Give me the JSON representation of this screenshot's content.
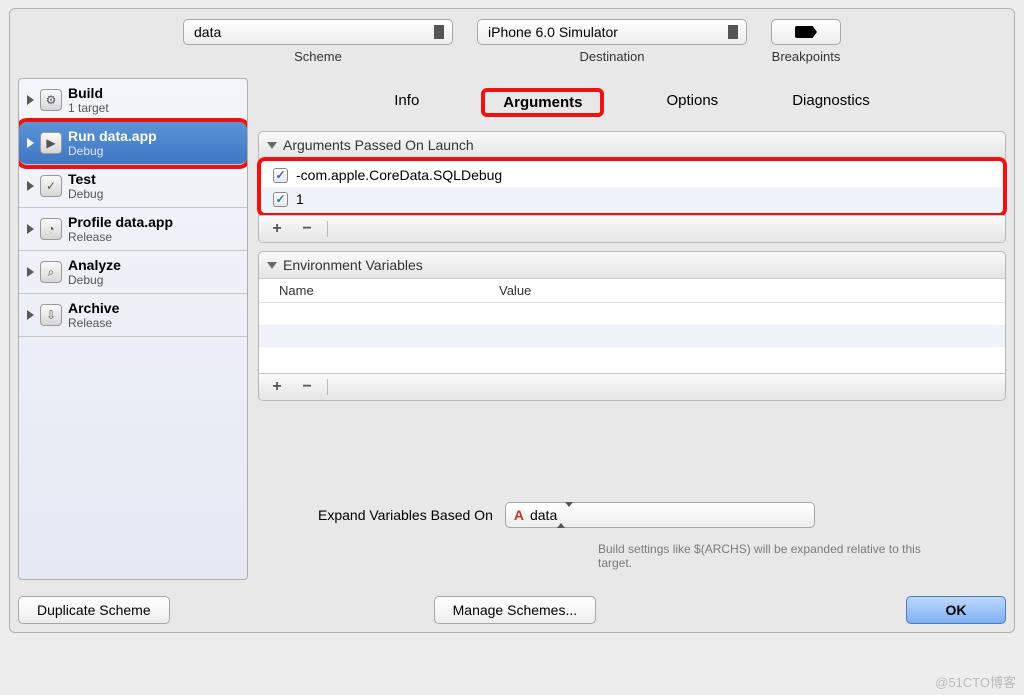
{
  "toolbar": {
    "scheme": {
      "value": "data",
      "label": "Scheme"
    },
    "destination": {
      "value": "iPhone 6.0 Simulator",
      "label": "Destination"
    },
    "breakpoints": {
      "label": "Breakpoints"
    }
  },
  "sidebar": {
    "items": [
      {
        "title": "Build",
        "sub": "1 target"
      },
      {
        "title": "Run data.app",
        "sub": "Debug"
      },
      {
        "title": "Test",
        "sub": "Debug"
      },
      {
        "title": "Profile data.app",
        "sub": "Release"
      },
      {
        "title": "Analyze",
        "sub": "Debug"
      },
      {
        "title": "Archive",
        "sub": "Release"
      }
    ]
  },
  "tabs": {
    "info": "Info",
    "arguments": "Arguments",
    "options": "Options",
    "diagnostics": "Diagnostics"
  },
  "arguments_panel": {
    "title": "Arguments Passed On Launch",
    "rows": [
      "-com.apple.CoreData.SQLDebug",
      "1"
    ]
  },
  "env_panel": {
    "title": "Environment Variables",
    "col_name": "Name",
    "col_value": "Value"
  },
  "expand": {
    "label": "Expand Variables Based On",
    "value": "data",
    "hint": "Build settings like $(ARCHS) will be expanded relative to this target."
  },
  "buttons": {
    "duplicate": "Duplicate Scheme",
    "manage": "Manage Schemes...",
    "ok": "OK"
  },
  "watermark": "@51CTO博客"
}
